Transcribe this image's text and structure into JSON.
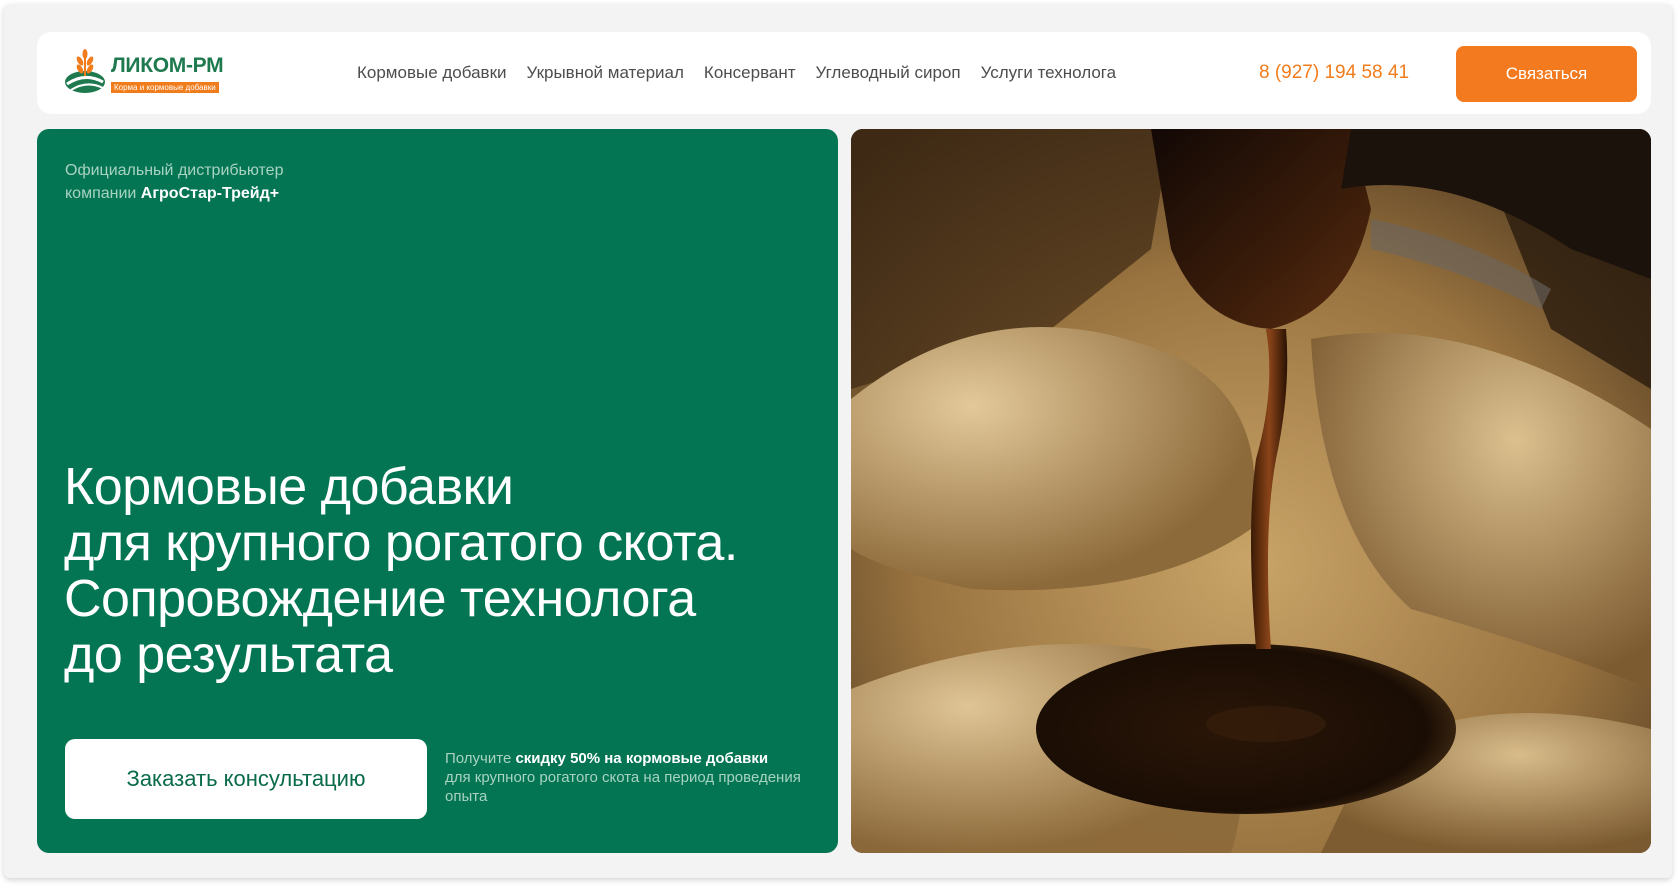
{
  "header": {
    "logo": {
      "title": "ЛИКОМ-РМ",
      "subtitle": "Корма и кормовые добавки"
    },
    "nav": [
      "Кормовые добавки",
      "Укрывной материал",
      "Консервант",
      "Углеводный сироп",
      "Услуги технолога"
    ],
    "phone": "8 (927) 194 58 41",
    "contact_button": "Связаться"
  },
  "hero": {
    "distributor_line1": "Официальный дистрибьютер",
    "distributor_line2_prefix": "компании ",
    "distributor_company": "АгроСтар-Трейд+",
    "headline": [
      "Кормовые добавки",
      "для крупного рогатого скота.",
      "Сопровождение технолога",
      "до результата"
    ],
    "consult_button": "Заказать консультацию",
    "promo_prefix": "Получите ",
    "promo_bold": "скидку 50% на кормовые добавки",
    "promo_rest": "для крупного рогатого скота на период проведения опыта"
  },
  "image": {
    "subject": "molasses-pouring-on-feed-photo"
  },
  "colors": {
    "brand_green": "#047553",
    "accent_orange": "#f47a1f",
    "page_bg": "#f3f3f3"
  }
}
